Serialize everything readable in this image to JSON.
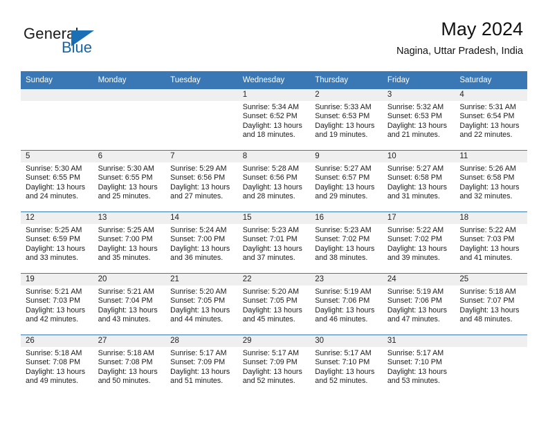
{
  "brand": {
    "name_part1": "General",
    "name_part2": "Blue",
    "logo_icon": "triangle-logo-icon"
  },
  "header": {
    "month_title": "May 2024",
    "location": "Nagina, Uttar Pradesh, India"
  },
  "calendar": {
    "weekday_headers": [
      "Sunday",
      "Monday",
      "Tuesday",
      "Wednesday",
      "Thursday",
      "Friday",
      "Saturday"
    ],
    "accent_color": "#3a78b5",
    "daynum_bg_color": "#efefef",
    "weeks": [
      [
        {
          "day": "",
          "sunrise": "",
          "sunset": "",
          "daylight_line1": "",
          "daylight_line2": ""
        },
        {
          "day": "",
          "sunrise": "",
          "sunset": "",
          "daylight_line1": "",
          "daylight_line2": ""
        },
        {
          "day": "",
          "sunrise": "",
          "sunset": "",
          "daylight_line1": "",
          "daylight_line2": ""
        },
        {
          "day": "1",
          "sunrise": "Sunrise: 5:34 AM",
          "sunset": "Sunset: 6:52 PM",
          "daylight_line1": "Daylight: 13 hours",
          "daylight_line2": "and 18 minutes."
        },
        {
          "day": "2",
          "sunrise": "Sunrise: 5:33 AM",
          "sunset": "Sunset: 6:53 PM",
          "daylight_line1": "Daylight: 13 hours",
          "daylight_line2": "and 19 minutes."
        },
        {
          "day": "3",
          "sunrise": "Sunrise: 5:32 AM",
          "sunset": "Sunset: 6:53 PM",
          "daylight_line1": "Daylight: 13 hours",
          "daylight_line2": "and 21 minutes."
        },
        {
          "day": "4",
          "sunrise": "Sunrise: 5:31 AM",
          "sunset": "Sunset: 6:54 PM",
          "daylight_line1": "Daylight: 13 hours",
          "daylight_line2": "and 22 minutes."
        }
      ],
      [
        {
          "day": "5",
          "sunrise": "Sunrise: 5:30 AM",
          "sunset": "Sunset: 6:55 PM",
          "daylight_line1": "Daylight: 13 hours",
          "daylight_line2": "and 24 minutes."
        },
        {
          "day": "6",
          "sunrise": "Sunrise: 5:30 AM",
          "sunset": "Sunset: 6:55 PM",
          "daylight_line1": "Daylight: 13 hours",
          "daylight_line2": "and 25 minutes."
        },
        {
          "day": "7",
          "sunrise": "Sunrise: 5:29 AM",
          "sunset": "Sunset: 6:56 PM",
          "daylight_line1": "Daylight: 13 hours",
          "daylight_line2": "and 27 minutes."
        },
        {
          "day": "8",
          "sunrise": "Sunrise: 5:28 AM",
          "sunset": "Sunset: 6:56 PM",
          "daylight_line1": "Daylight: 13 hours",
          "daylight_line2": "and 28 minutes."
        },
        {
          "day": "9",
          "sunrise": "Sunrise: 5:27 AM",
          "sunset": "Sunset: 6:57 PM",
          "daylight_line1": "Daylight: 13 hours",
          "daylight_line2": "and 29 minutes."
        },
        {
          "day": "10",
          "sunrise": "Sunrise: 5:27 AM",
          "sunset": "Sunset: 6:58 PM",
          "daylight_line1": "Daylight: 13 hours",
          "daylight_line2": "and 31 minutes."
        },
        {
          "day": "11",
          "sunrise": "Sunrise: 5:26 AM",
          "sunset": "Sunset: 6:58 PM",
          "daylight_line1": "Daylight: 13 hours",
          "daylight_line2": "and 32 minutes."
        }
      ],
      [
        {
          "day": "12",
          "sunrise": "Sunrise: 5:25 AM",
          "sunset": "Sunset: 6:59 PM",
          "daylight_line1": "Daylight: 13 hours",
          "daylight_line2": "and 33 minutes."
        },
        {
          "day": "13",
          "sunrise": "Sunrise: 5:25 AM",
          "sunset": "Sunset: 7:00 PM",
          "daylight_line1": "Daylight: 13 hours",
          "daylight_line2": "and 35 minutes."
        },
        {
          "day": "14",
          "sunrise": "Sunrise: 5:24 AM",
          "sunset": "Sunset: 7:00 PM",
          "daylight_line1": "Daylight: 13 hours",
          "daylight_line2": "and 36 minutes."
        },
        {
          "day": "15",
          "sunrise": "Sunrise: 5:23 AM",
          "sunset": "Sunset: 7:01 PM",
          "daylight_line1": "Daylight: 13 hours",
          "daylight_line2": "and 37 minutes."
        },
        {
          "day": "16",
          "sunrise": "Sunrise: 5:23 AM",
          "sunset": "Sunset: 7:02 PM",
          "daylight_line1": "Daylight: 13 hours",
          "daylight_line2": "and 38 minutes."
        },
        {
          "day": "17",
          "sunrise": "Sunrise: 5:22 AM",
          "sunset": "Sunset: 7:02 PM",
          "daylight_line1": "Daylight: 13 hours",
          "daylight_line2": "and 39 minutes."
        },
        {
          "day": "18",
          "sunrise": "Sunrise: 5:22 AM",
          "sunset": "Sunset: 7:03 PM",
          "daylight_line1": "Daylight: 13 hours",
          "daylight_line2": "and 41 minutes."
        }
      ],
      [
        {
          "day": "19",
          "sunrise": "Sunrise: 5:21 AM",
          "sunset": "Sunset: 7:03 PM",
          "daylight_line1": "Daylight: 13 hours",
          "daylight_line2": "and 42 minutes."
        },
        {
          "day": "20",
          "sunrise": "Sunrise: 5:21 AM",
          "sunset": "Sunset: 7:04 PM",
          "daylight_line1": "Daylight: 13 hours",
          "daylight_line2": "and 43 minutes."
        },
        {
          "day": "21",
          "sunrise": "Sunrise: 5:20 AM",
          "sunset": "Sunset: 7:05 PM",
          "daylight_line1": "Daylight: 13 hours",
          "daylight_line2": "and 44 minutes."
        },
        {
          "day": "22",
          "sunrise": "Sunrise: 5:20 AM",
          "sunset": "Sunset: 7:05 PM",
          "daylight_line1": "Daylight: 13 hours",
          "daylight_line2": "and 45 minutes."
        },
        {
          "day": "23",
          "sunrise": "Sunrise: 5:19 AM",
          "sunset": "Sunset: 7:06 PM",
          "daylight_line1": "Daylight: 13 hours",
          "daylight_line2": "and 46 minutes."
        },
        {
          "day": "24",
          "sunrise": "Sunrise: 5:19 AM",
          "sunset": "Sunset: 7:06 PM",
          "daylight_line1": "Daylight: 13 hours",
          "daylight_line2": "and 47 minutes."
        },
        {
          "day": "25",
          "sunrise": "Sunrise: 5:18 AM",
          "sunset": "Sunset: 7:07 PM",
          "daylight_line1": "Daylight: 13 hours",
          "daylight_line2": "and 48 minutes."
        }
      ],
      [
        {
          "day": "26",
          "sunrise": "Sunrise: 5:18 AM",
          "sunset": "Sunset: 7:08 PM",
          "daylight_line1": "Daylight: 13 hours",
          "daylight_line2": "and 49 minutes."
        },
        {
          "day": "27",
          "sunrise": "Sunrise: 5:18 AM",
          "sunset": "Sunset: 7:08 PM",
          "daylight_line1": "Daylight: 13 hours",
          "daylight_line2": "and 50 minutes."
        },
        {
          "day": "28",
          "sunrise": "Sunrise: 5:17 AM",
          "sunset": "Sunset: 7:09 PM",
          "daylight_line1": "Daylight: 13 hours",
          "daylight_line2": "and 51 minutes."
        },
        {
          "day": "29",
          "sunrise": "Sunrise: 5:17 AM",
          "sunset": "Sunset: 7:09 PM",
          "daylight_line1": "Daylight: 13 hours",
          "daylight_line2": "and 52 minutes."
        },
        {
          "day": "30",
          "sunrise": "Sunrise: 5:17 AM",
          "sunset": "Sunset: 7:10 PM",
          "daylight_line1": "Daylight: 13 hours",
          "daylight_line2": "and 52 minutes."
        },
        {
          "day": "31",
          "sunrise": "Sunrise: 5:17 AM",
          "sunset": "Sunset: 7:10 PM",
          "daylight_line1": "Daylight: 13 hours",
          "daylight_line2": "and 53 minutes."
        },
        {
          "day": "",
          "sunrise": "",
          "sunset": "",
          "daylight_line1": "",
          "daylight_line2": ""
        }
      ]
    ]
  }
}
